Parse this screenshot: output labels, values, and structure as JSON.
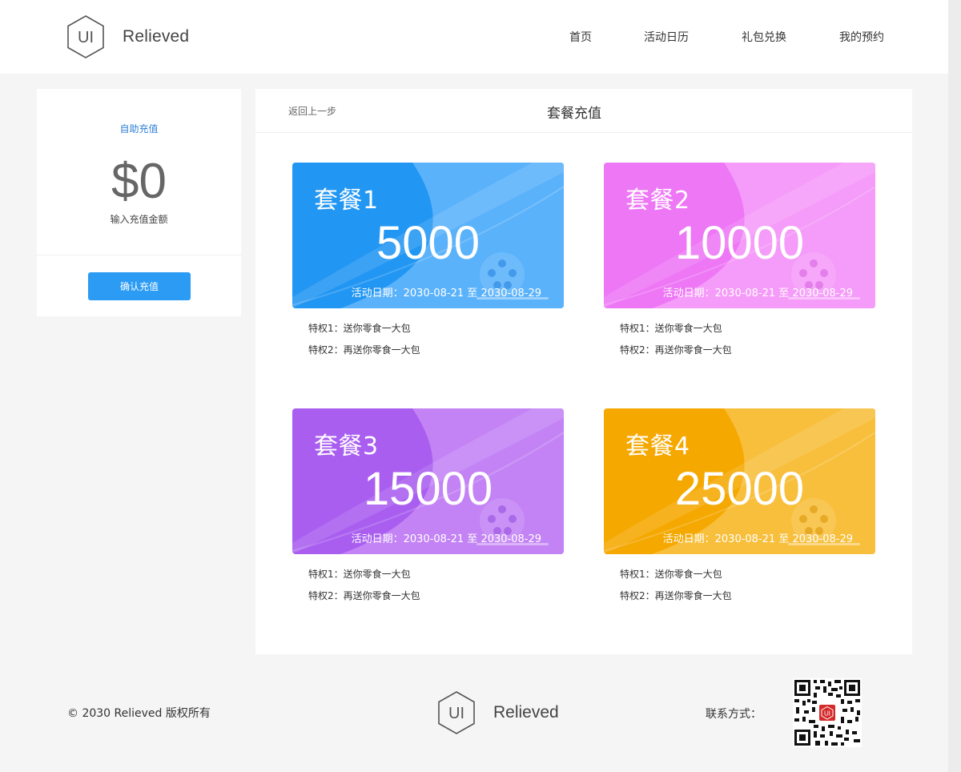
{
  "brand": {
    "logo_text": "UI",
    "name": "Relieved"
  },
  "nav": [
    {
      "label": "首页"
    },
    {
      "label": "活动日历"
    },
    {
      "label": "礼包兑换"
    },
    {
      "label": "我的预约"
    }
  ],
  "sidebar": {
    "title": "自助充值",
    "amount": "$0",
    "hint": "输入充值金额",
    "confirm_label": "确认充值"
  },
  "main": {
    "back_label": "返回上一步",
    "heading": "套餐充值"
  },
  "packages": [
    {
      "name": "套餐1",
      "value": "5000",
      "date": "活动日期：2030-08-21 至 2030-08-29",
      "perk1": "特权1：送你零食一大包",
      "perk2": "特权2：再送你零食一大包",
      "color_a": "#2196f3",
      "color_b": "#5ab2fb"
    },
    {
      "name": "套餐2",
      "value": "10000",
      "date": "活动日期：2030-08-21 至 2030-08-29",
      "perk1": "特权1：送你零食一大包",
      "perk2": "特权2：再送你零食一大包",
      "color_a": "#ee77f6",
      "color_b": "#f59bf9"
    },
    {
      "name": "套餐3",
      "value": "15000",
      "date": "活动日期：2030-08-21 至 2030-08-29",
      "perk1": "特权1：送你零食一大包",
      "perk2": "特权2：再送你零食一大包",
      "color_a": "#a95ef0",
      "color_b": "#c383f5"
    },
    {
      "name": "套餐4",
      "value": "25000",
      "date": "活动日期：2030-08-21 至 2030-08-29",
      "perk1": "特权1：送你零食一大包",
      "perk2": "特权2：再送你零食一大包",
      "color_a": "#f5a800",
      "color_b": "#f8bf3c"
    }
  ],
  "footer": {
    "copyright": "© 2030 Relieved 版权所有",
    "contact_label": "联系方式：",
    "qr_badge": "UI"
  },
  "icons": {
    "logo": "hexagon-logo-icon",
    "card_deco": "film-reel-icon",
    "qr": "qr-code-icon"
  },
  "colors": {
    "accent": "#2b9bf4",
    "link": "#2f7fd6",
    "qr_badge": "#d42a2a"
  }
}
